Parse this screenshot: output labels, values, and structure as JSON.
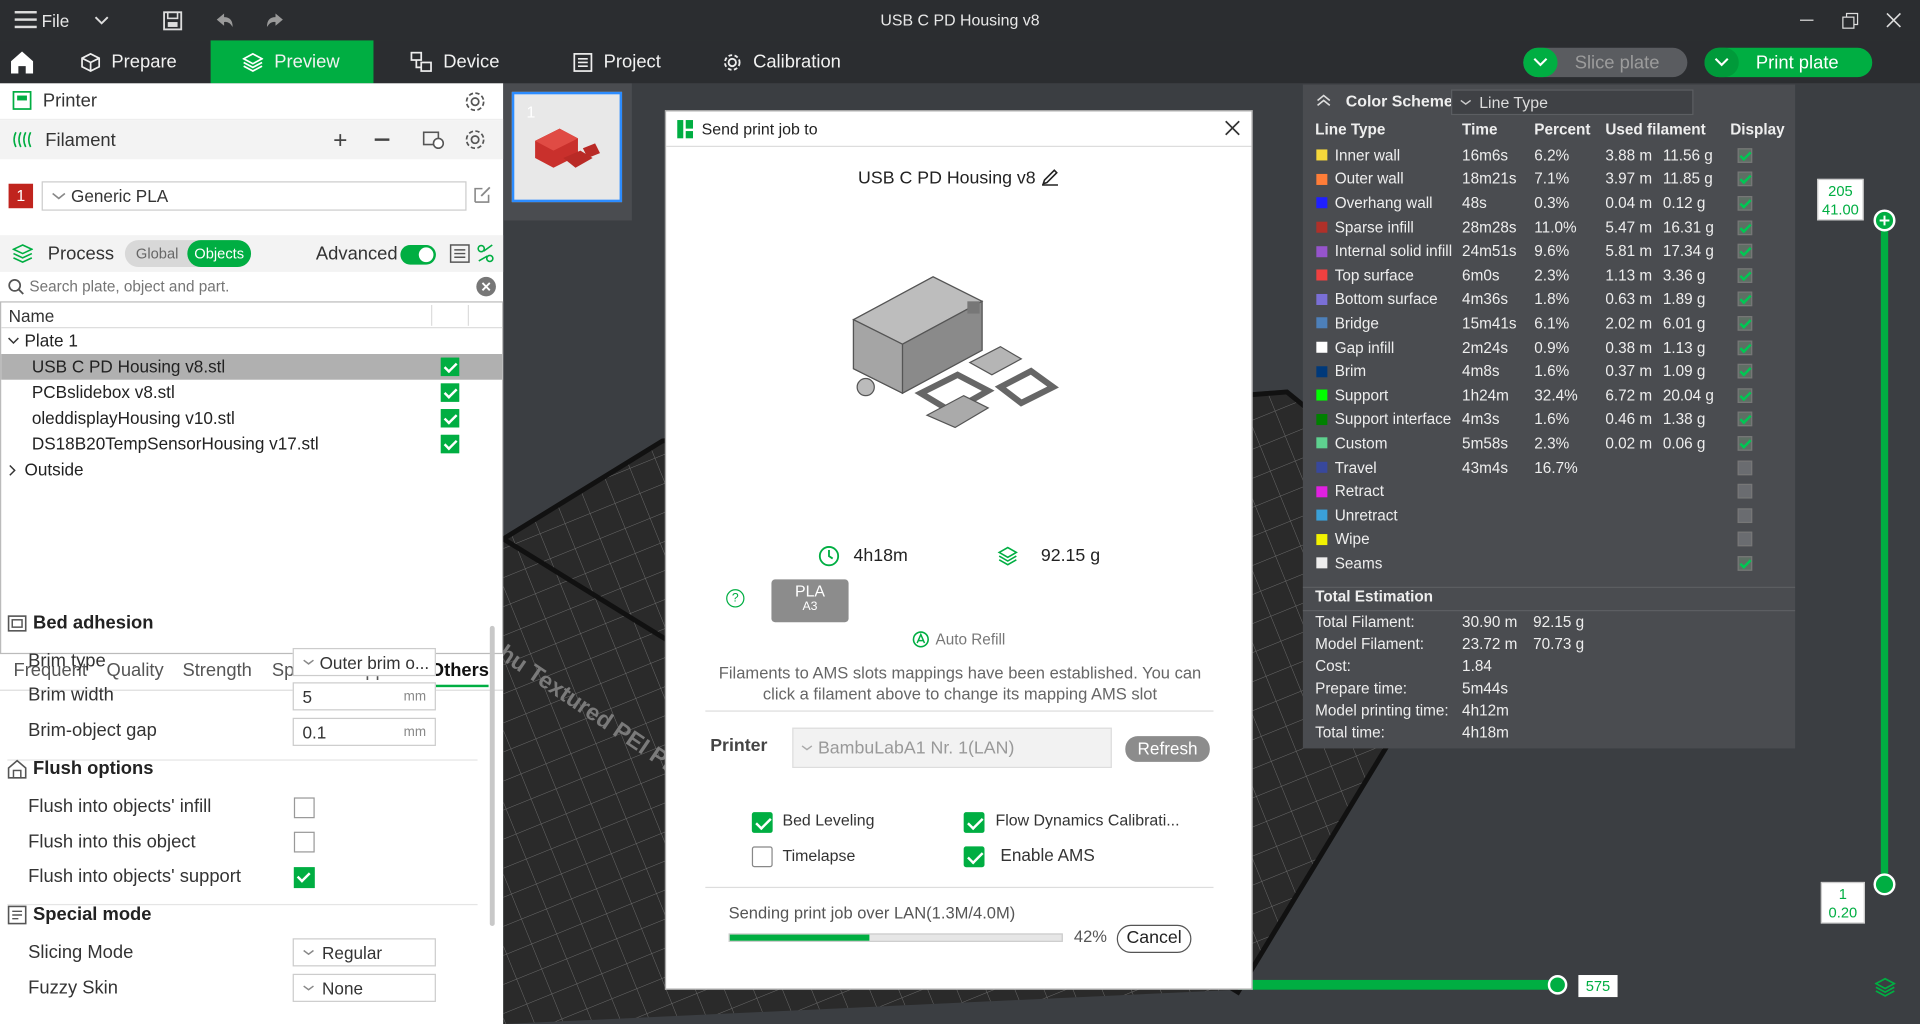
{
  "window": {
    "title": "USB C PD Housing v8",
    "file_menu": "File"
  },
  "nav": {
    "tabs": [
      {
        "label": "Prepare"
      },
      {
        "label": "Preview"
      },
      {
        "label": "Device"
      },
      {
        "label": "Project"
      },
      {
        "label": "Calibration"
      }
    ],
    "slice_label": "Slice plate",
    "print_label": "Print plate"
  },
  "left": {
    "printer_label": "Printer",
    "filament_label": "Filament",
    "filament_slot": "1",
    "filament_name": "Generic PLA",
    "process_label": "Process",
    "global_label": "Global",
    "objects_label": "Objects",
    "advanced_label": "Advanced",
    "search_placeholder": "Search plate, object and part.",
    "tree_header": "Name",
    "plate_label": "Plate 1",
    "objects": [
      "USB C PD Housing v8.stl",
      "PCBslidebox v8.stl",
      "oleddisplayHousing v10.stl",
      "DS18B20TempSensorHousing v17.stl"
    ],
    "outside_label": "Outside",
    "param_tabs": [
      "Frequent",
      "Quality",
      "Strength",
      "Speed",
      "Support",
      "Others"
    ],
    "bed_adhesion": {
      "title": "Bed adhesion",
      "brim_type_label": "Brim type",
      "brim_type_value": "Outer brim o...",
      "brim_width_label": "Brim width",
      "brim_width_value": "5",
      "brim_gap_label": "Brim-object gap",
      "brim_gap_value": "0.1",
      "unit": "mm"
    },
    "flush": {
      "title": "Flush options",
      "infill_label": "Flush into objects' infill",
      "object_label": "Flush into this object",
      "support_label": "Flush into objects' support"
    },
    "special": {
      "title": "Special mode",
      "slicing_label": "Slicing Mode",
      "slicing_value": "Regular",
      "fuzzy_label": "Fuzzy Skin",
      "fuzzy_value": "None"
    }
  },
  "plate_thumb_number": "1",
  "bed_text": "hu Textured PEI Pl",
  "dialog": {
    "title": "Send print job to",
    "job_name": "USB C PD Housing v8",
    "time": "4h18m",
    "weight": "92.15 g",
    "filament_type": "PLA",
    "filament_slot": "A3",
    "auto_refill": "Auto Refill",
    "mapping_note": "Filaments to AMS slots mappings have been established. You can click a filament above to change its mapping AMS slot",
    "printer_label": "Printer",
    "printer_value": "BambuLabA1 Nr. 1(LAN)",
    "refresh_label": "Refresh",
    "bed_leveling": "Bed Leveling",
    "flow_dynamics": "Flow Dynamics Calibrati...",
    "timelapse": "Timelapse",
    "enable_ams": "Enable AMS",
    "progress_text": "Sending print job over LAN(1.3M/4.0M)",
    "progress_percent": "42%",
    "progress_fraction": 0.42,
    "cancel_label": "Cancel"
  },
  "legend": {
    "scheme_label": "Color Scheme",
    "scheme_value": "Line Type",
    "headers": [
      "Line Type",
      "Time",
      "Percent",
      "Used filament",
      "Display"
    ],
    "rows": [
      {
        "name": "Inner wall",
        "color": "#f6d83b",
        "time": "16m6s",
        "percent": "6.2%",
        "len": "3.88 m",
        "mass": "11.56 g",
        "on": true
      },
      {
        "name": "Outer wall",
        "color": "#ff7d38",
        "time": "18m21s",
        "percent": "7.1%",
        "len": "3.97 m",
        "mass": "11.85 g",
        "on": true
      },
      {
        "name": "Overhang wall",
        "color": "#1f1fff",
        "time": "48s",
        "percent": "0.3%",
        "len": "0.04 m",
        "mass": "0.12 g",
        "on": true
      },
      {
        "name": "Sparse infill",
        "color": "#b03029",
        "time": "28m28s",
        "percent": "11.0%",
        "len": "5.47 m",
        "mass": "16.31 g",
        "on": true
      },
      {
        "name": "Internal solid infill",
        "color": "#9654cc",
        "time": "24m51s",
        "percent": "9.6%",
        "len": "5.81 m",
        "mass": "17.34 g",
        "on": true
      },
      {
        "name": "Top surface",
        "color": "#f04040",
        "time": "6m0s",
        "percent": "2.3%",
        "len": "1.13 m",
        "mass": "3.36 g",
        "on": true
      },
      {
        "name": "Bottom surface",
        "color": "#7a6fd6",
        "time": "4m36s",
        "percent": "1.8%",
        "len": "0.63 m",
        "mass": "1.89 g",
        "on": true
      },
      {
        "name": "Bridge",
        "color": "#4d80ba",
        "time": "15m41s",
        "percent": "6.1%",
        "len": "2.02 m",
        "mass": "6.01 g",
        "on": true
      },
      {
        "name": "Gap infill",
        "color": "#ffffff",
        "time": "2m24s",
        "percent": "0.9%",
        "len": "0.38 m",
        "mass": "1.13 g",
        "on": true
      },
      {
        "name": "Brim",
        "color": "#00397a",
        "time": "4m8s",
        "percent": "1.6%",
        "len": "0.37 m",
        "mass": "1.09 g",
        "on": true
      },
      {
        "name": "Support",
        "color": "#00ff00",
        "time": "1h24m",
        "percent": "32.4%",
        "len": "6.72 m",
        "mass": "20.04 g",
        "on": true
      },
      {
        "name": "Support interface",
        "color": "#008000",
        "time": "4m3s",
        "percent": "1.6%",
        "len": "0.46 m",
        "mass": "1.38 g",
        "on": true
      },
      {
        "name": "Custom",
        "color": "#5ed18f",
        "time": "5m58s",
        "percent": "2.3%",
        "len": "0.02 m",
        "mass": "0.06 g",
        "on": true
      },
      {
        "name": "Travel",
        "color": "#38489c",
        "time": "43m4s",
        "percent": "16.7%",
        "len": "",
        "mass": "",
        "on": false
      },
      {
        "name": "Retract",
        "color": "#e020e0",
        "time": "",
        "percent": "",
        "len": "",
        "mass": "",
        "on": false
      },
      {
        "name": "Unretract",
        "color": "#3aa0d8",
        "time": "",
        "percent": "",
        "len": "",
        "mass": "",
        "on": false
      },
      {
        "name": "Wipe",
        "color": "#f2f200",
        "time": "",
        "percent": "",
        "len": "",
        "mass": "",
        "on": false
      },
      {
        "name": "Seams",
        "color": "#eeeeee",
        "time": "",
        "percent": "",
        "len": "",
        "mass": "",
        "on": true
      }
    ],
    "total_title": "Total Estimation",
    "totals": [
      {
        "label": "Total Filament:",
        "v1": "30.90 m",
        "v2": "92.15 g"
      },
      {
        "label": "Model Filament:",
        "v1": "23.72 m",
        "v2": "70.73 g"
      },
      {
        "label": "Cost:",
        "v1": "1.84",
        "v2": ""
      },
      {
        "label": "Prepare time:",
        "v1": "5m44s",
        "v2": ""
      },
      {
        "label": "Model printing time:",
        "v1": "4h12m",
        "v2": ""
      },
      {
        "label": "Total time:",
        "v1": "4h18m",
        "v2": ""
      }
    ]
  },
  "slider": {
    "top_layer": "205",
    "top_height": "41.00",
    "bottom_layer": "1",
    "bottom_height": "0.20",
    "horizontal_value": "575"
  }
}
